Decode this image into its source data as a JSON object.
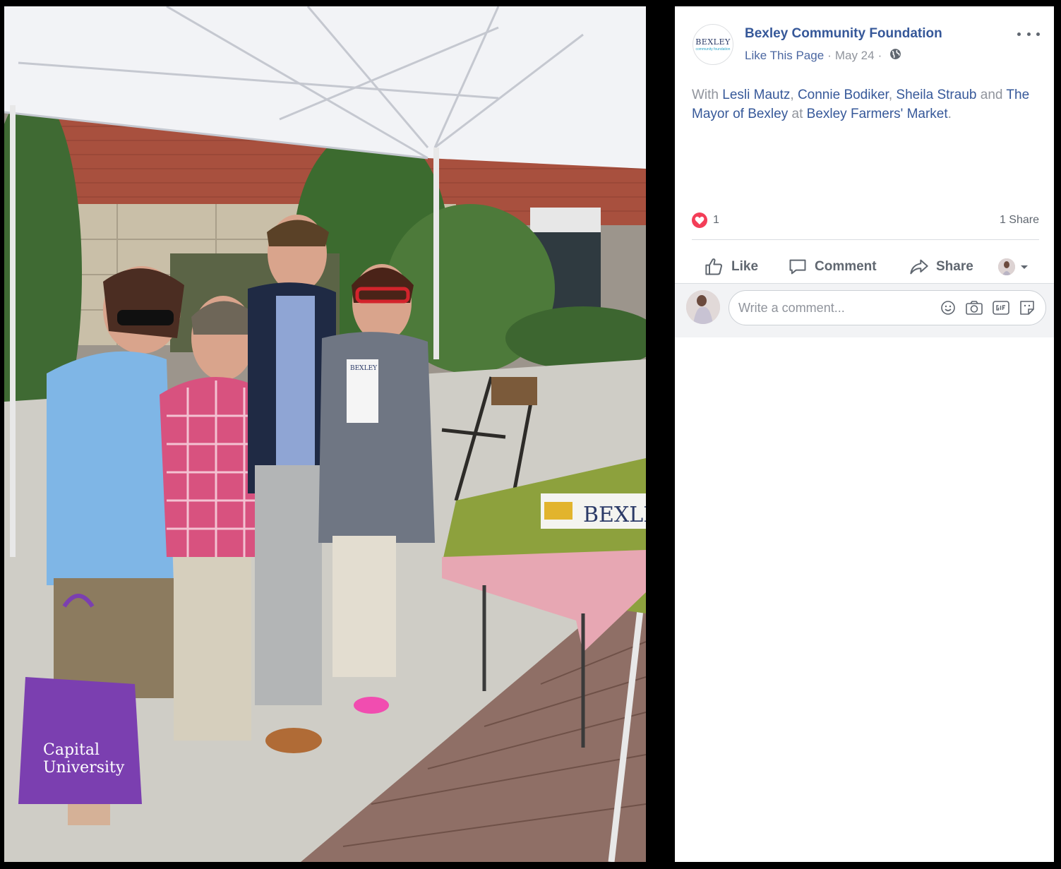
{
  "post": {
    "page_name": "Bexley Community Foundation",
    "logo": {
      "line1": "BEXLEY",
      "line2": "community foundation"
    },
    "like_page": "Like This Page",
    "separator": "·",
    "date": "May 24",
    "text": {
      "with": "With",
      "tagged": [
        "Lesli Mautz",
        "Connie Bodiker",
        "Sheila Straub",
        "The Mayor of Bexley"
      ],
      "comma": ",",
      "and": "and",
      "at": "at",
      "location": "Bexley Farmers' Market",
      "period": "."
    },
    "reaction_count": "1",
    "shares": "1 Share"
  },
  "actions": {
    "like": "Like",
    "comment": "Comment",
    "share": "Share"
  },
  "comment_box": {
    "placeholder": "Write a comment..."
  },
  "photo": {
    "bag_line1": "Capital",
    "bag_line2": "University",
    "table_sign": "BEXLE",
    "brochure": "BEXLEY"
  },
  "colors": {
    "link": "#365899",
    "muted": "#90949c",
    "heart": "#f33e58",
    "bag": "#7b3fb0"
  },
  "icons": [
    "heart-icon",
    "globe-icon",
    "more-icon",
    "like-icon",
    "comment-icon",
    "share-icon",
    "chevron-down-icon",
    "emoji-icon",
    "camera-icon",
    "gif-icon",
    "sticker-icon"
  ]
}
